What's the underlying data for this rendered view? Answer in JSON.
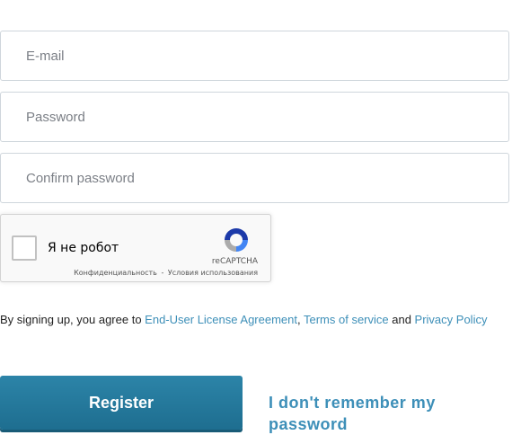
{
  "form": {
    "email_placeholder": "E-mail",
    "password_placeholder": "Password",
    "confirm_placeholder": "Confirm password"
  },
  "captcha": {
    "label": "Я не робот",
    "brand": "reCAPTCHA",
    "privacy_link": "Конфиденциальность",
    "separator": "-",
    "terms_link": "Условия использования"
  },
  "agreement": {
    "prefix": "By signing up, you agree to ",
    "eula": "End-User License Agreement",
    "comma": ", ",
    "tos": "Terms of service",
    "and": " and ",
    "privacy": "Privacy Policy"
  },
  "actions": {
    "register_label": "Register",
    "forgot_label": "I don't remember my password"
  },
  "colors": {
    "accent": "#2c84a8",
    "link": "#3d8fb8"
  }
}
